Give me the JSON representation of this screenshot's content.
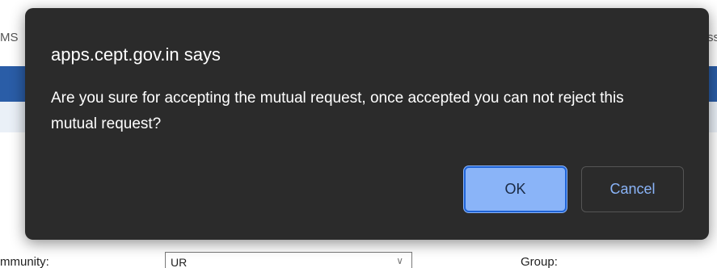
{
  "background": {
    "left_edge_text": "MS",
    "right_edge_text": "ss",
    "form_label_left": "mmunity:",
    "form_select_value": "UR",
    "form_label_right": "Group:"
  },
  "dialog": {
    "title": "apps.cept.gov.in says",
    "message": "Are you sure for accepting the mutual request, once accepted you can not reject this mutual request?",
    "ok_label": "OK",
    "cancel_label": "Cancel"
  },
  "colors": {
    "dialog_bg": "#2b2b2b",
    "ok_bg": "#8ab4f8",
    "cancel_text": "#8ab4f8",
    "header_band": "#2a5da7"
  },
  "icons": {
    "select_chevron": "chevron-down-icon"
  }
}
